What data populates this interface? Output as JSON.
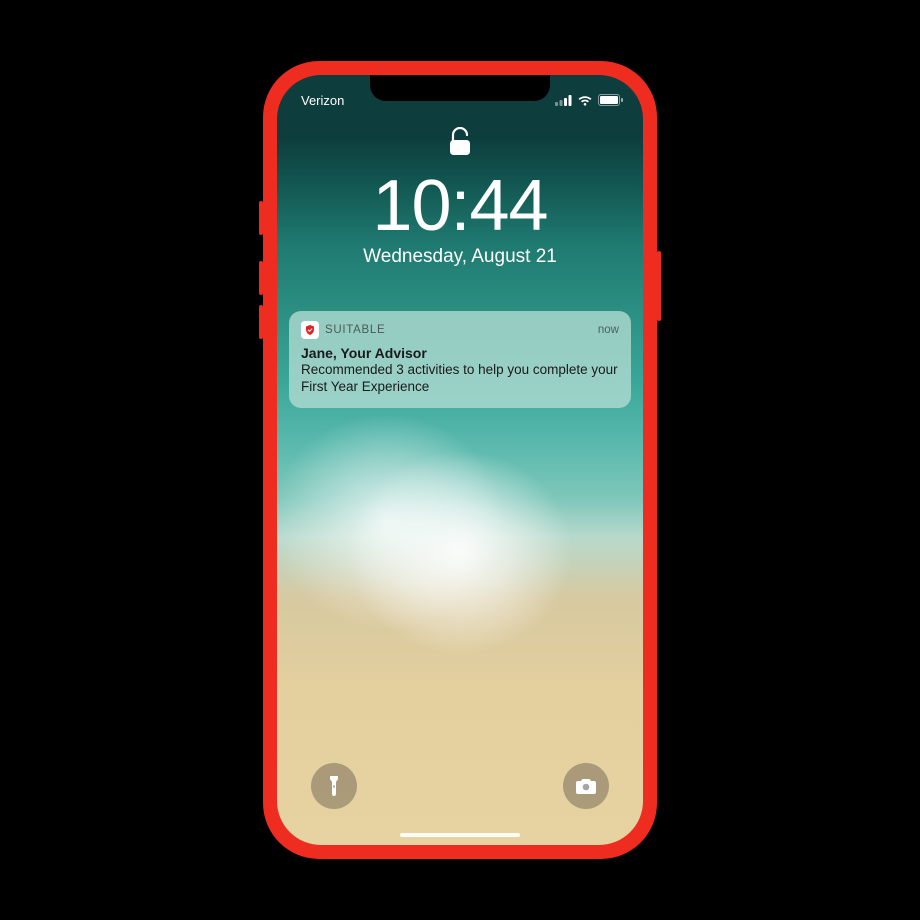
{
  "statusbar": {
    "carrier": "Verizon"
  },
  "lockscreen": {
    "time": "10:44",
    "date": "Wednesday, August 21"
  },
  "notification": {
    "app_name": "SUITABLE",
    "timestamp": "now",
    "title": "Jane, Your Advisor",
    "body": "Recommended 3 activities to help you complete your First Year Experience"
  }
}
